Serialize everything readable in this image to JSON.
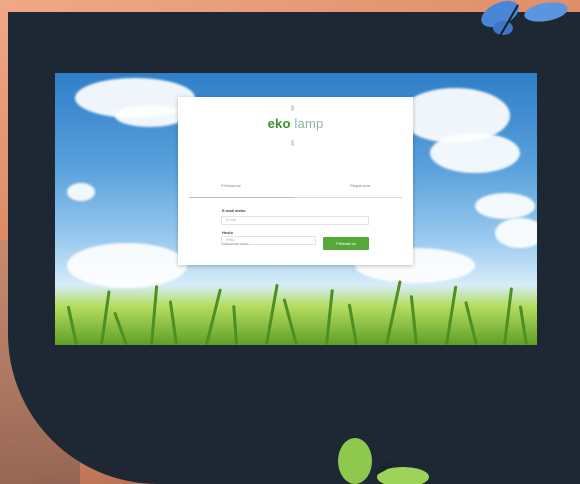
{
  "login_screen": {
    "logo": {
      "word1": "eko",
      "word2": "lamp"
    },
    "tabs": [
      {
        "label": "Prihlasenie",
        "active": true
      },
      {
        "label": "Registracia",
        "active": false
      }
    ],
    "email_label": "E-mail alebo",
    "email_placeholder": "E-mail",
    "password_label": "Heslo",
    "password_placeholder": "Heslo",
    "forgot_link": "Zabudli ste heslo",
    "login_button": "Prihlasit sa"
  },
  "colors": {
    "panel": "#1e2734",
    "brand_green": "#3d8f2f",
    "button_green": "#56a83a",
    "butterfly_blue": "#4a86d8",
    "butterfly_green": "#8ec94d"
  },
  "icons": [
    "butterfly-icon-blue",
    "butterfly-icon-green"
  ]
}
